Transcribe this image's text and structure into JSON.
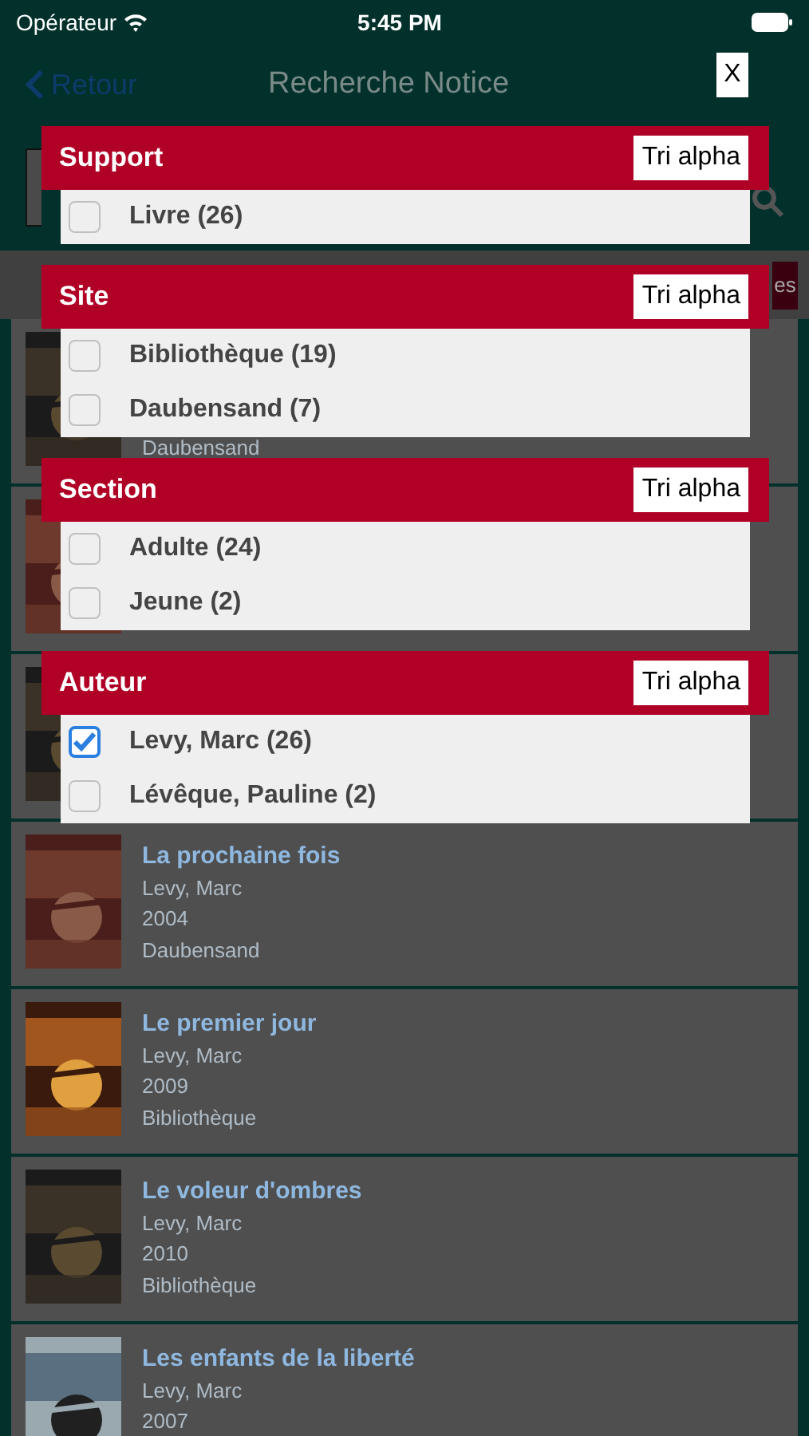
{
  "status_bar": {
    "carrier": "Opérateur",
    "time": "5:45 PM"
  },
  "nav": {
    "back": "Retour",
    "title": "Recherche Notice"
  },
  "filter_button": {
    "label": "es"
  },
  "results": [
    {
      "kind": "picture",
      "location": "Daubensand"
    },
    {
      "kind": "picture"
    },
    {
      "kind": "picture"
    },
    {
      "title": "La prochaine fois",
      "author": "Levy, Marc",
      "year": "2004",
      "location": "Daubensand"
    },
    {
      "title": "Le premier jour",
      "author": "Levy, Marc",
      "year": "2009",
      "location": "Bibliothèque"
    },
    {
      "title": "Le voleur d'ombres",
      "author": "Levy, Marc",
      "year": "2010",
      "location": "Bibliothèque"
    },
    {
      "title": "Les enfants de la liberté",
      "author": "Levy, Marc",
      "year": "2007"
    }
  ],
  "close_button": {
    "label": "X"
  },
  "filters": [
    {
      "title": "Support",
      "sort": "Tri alpha",
      "options": [
        {
          "label": "Livre (26)",
          "checked": false
        }
      ]
    },
    {
      "title": "Site",
      "sort": "Tri alpha",
      "options": [
        {
          "label": "Bibliothèque (19)",
          "checked": false
        },
        {
          "label": "Daubensand (7)",
          "checked": false
        }
      ]
    },
    {
      "title": "Section",
      "sort": "Tri alpha",
      "options": [
        {
          "label": "Adulte (24)",
          "checked": false
        },
        {
          "label": "Jeune (2)",
          "checked": false
        }
      ]
    },
    {
      "title": "Auteur",
      "sort": "Tri alpha",
      "options": [
        {
          "label": "Levy, Marc (26)",
          "checked": true
        },
        {
          "label": "Lévêque, Pauline (2)",
          "checked": false
        }
      ]
    }
  ]
}
